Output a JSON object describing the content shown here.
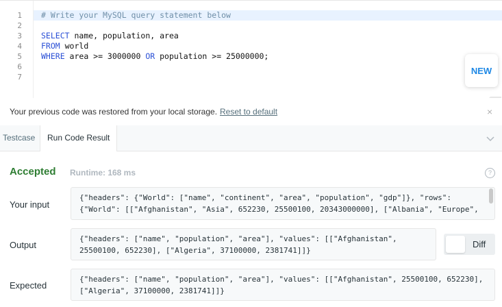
{
  "editor": {
    "line_numbers": [
      "1",
      "2",
      "3",
      "4",
      "5",
      "6",
      "7"
    ],
    "lines": {
      "l1": "# Write your MySQL query statement below",
      "l3_kw": "SELECT",
      "l3_rest": " name, population, area",
      "l4_kw": "FROM",
      "l4_rest": " world",
      "l5_kw1": "WHERE",
      "l5_a": " area >= 3000000 ",
      "l5_kw2": "OR",
      "l5_b": " population >= 25000000;"
    },
    "new_label": "NEW"
  },
  "restore": {
    "text": "Your previous code was restored from your local storage.",
    "link": "Reset to default",
    "close": "×"
  },
  "tabs": [
    "Testcase",
    "Run Code Result"
  ],
  "result": {
    "status": "Accepted",
    "runtime": "Runtime: 168 ms",
    "help": "?",
    "your_input_label": "Your input",
    "your_input": "{\"headers\": {\"World\": [\"name\", \"continent\", \"area\", \"population\", \"gdp\"]}, \"rows\":\n{\"World\": [[\"Afghanistan\", \"Asia\", 652230, 25500100, 20343000000], [\"Albania\", \"Europe\",",
    "output_label": "Output",
    "output": "{\"headers\": [\"name\", \"population\", \"area\"], \"values\": [[\"Afghanistan\",\n25500100, 652230], [\"Algeria\", 37100000, 2381741]]}",
    "expected_label": "Expected",
    "expected": "{\"headers\": [\"name\", \"population\", \"area\"], \"values\": [[\"Afghanistan\", 25500100, 652230],\n[\"Algeria\", 37100000, 2381741]]}",
    "diff_label": "Diff"
  }
}
